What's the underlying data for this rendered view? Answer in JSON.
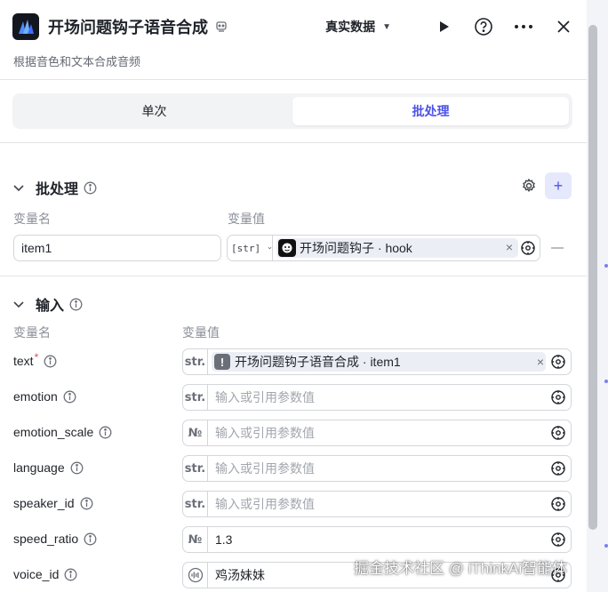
{
  "header": {
    "title": "开场问题钩子语音合成",
    "subtitle": "根据音色和文本合成音频",
    "data_select": "真实数据"
  },
  "mode_tabs": {
    "single": "单次",
    "batch": "批处理",
    "active": "batch"
  },
  "batch": {
    "title": "批处理",
    "col_name": "变量名",
    "col_value": "变量值",
    "item_name": "item1",
    "item_type": "[str]",
    "ref_label": "开场问题钩子 · hook"
  },
  "inputs": {
    "title": "输入",
    "col_name": "变量名",
    "col_value": "变量值",
    "rows": [
      {
        "name": "text",
        "required": true,
        "type": "str.",
        "ref": "开场问题钩子语音合成 · item1"
      },
      {
        "name": "emotion",
        "type": "str.",
        "placeholder": "输入或引用参数值"
      },
      {
        "name": "emotion_scale",
        "type": "№",
        "placeholder": "输入或引用参数值"
      },
      {
        "name": "language",
        "type": "str.",
        "placeholder": "输入或引用参数值"
      },
      {
        "name": "speaker_id",
        "type": "str.",
        "placeholder": "输入或引用参数值"
      },
      {
        "name": "speed_ratio",
        "type": "№",
        "value": "1.3"
      },
      {
        "name": "voice_id",
        "value": "鸡汤妹妹"
      }
    ]
  },
  "watermark": "掘金技术社区 @ iThinkAi智能体",
  "colors": {
    "accent": "#4d53e8",
    "required": "#e5484d",
    "muted": "#8a8f99"
  }
}
